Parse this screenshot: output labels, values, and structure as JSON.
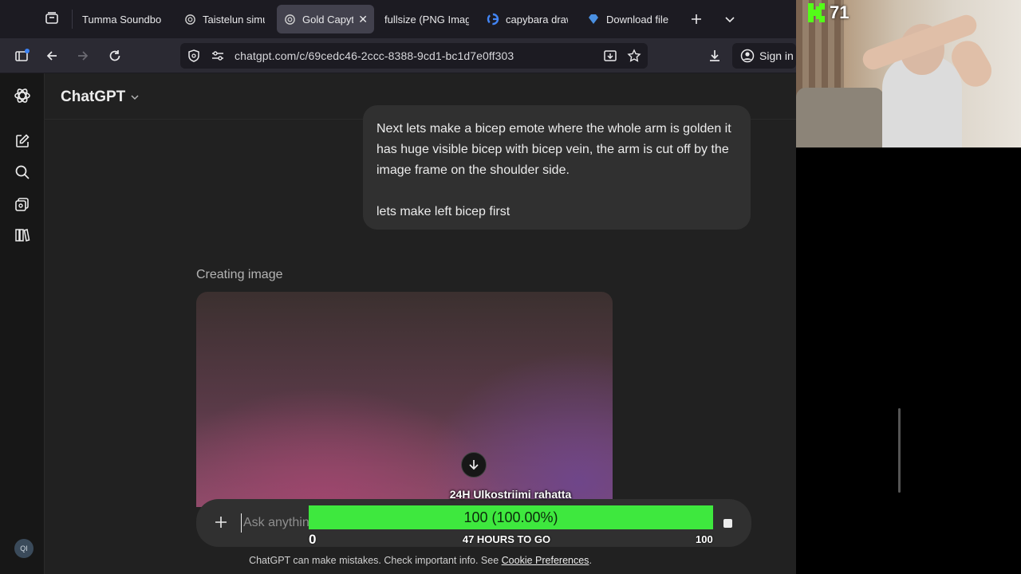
{
  "tabs": [
    {
      "title": "Tumma Soundbo",
      "icon": "none"
    },
    {
      "title": "Taistelun simu",
      "icon": "openai-icon"
    },
    {
      "title": "Gold Capyt",
      "icon": "openai-icon",
      "active": true
    },
    {
      "title": "fullsize (PNG Imag",
      "icon": "none"
    },
    {
      "title": "capybara draw",
      "icon": "google-icon"
    },
    {
      "title": "Download file",
      "icon": "gem-icon"
    }
  ],
  "navbar": {
    "url": "chatgpt.com/c/69cedc46-2ccc-8388-9cd1-bc1d7e0ff303",
    "signin_label": "Sign in"
  },
  "app": {
    "model_name": "ChatGPT",
    "user_message": {
      "para1": "Next lets make a bicep emote where the whole arm is golden it has huge visible bicep with bicep vein, the arm is cut off by the image frame on the shoulder side.",
      "para2": "lets make left bicep first"
    },
    "creating_label": "Creating image",
    "composer_placeholder": "Ask anything",
    "disclaimer_text": "ChatGPT can make mistakes. Check important info. See ",
    "disclaimer_link": "Cookie Preferences",
    "disclaimer_end": ".",
    "avatar_initials": "QI"
  },
  "overlay": {
    "goal_title": "24H Ulkostriimi rahatta",
    "goal_value_text": "100 (100.00%)",
    "goal_fraction": 1.0,
    "goal_min": "0",
    "goal_max": "100",
    "goal_sub": "47 HOURS TO GO",
    "viewer_count": "71",
    "accent": "#3ee83e"
  }
}
